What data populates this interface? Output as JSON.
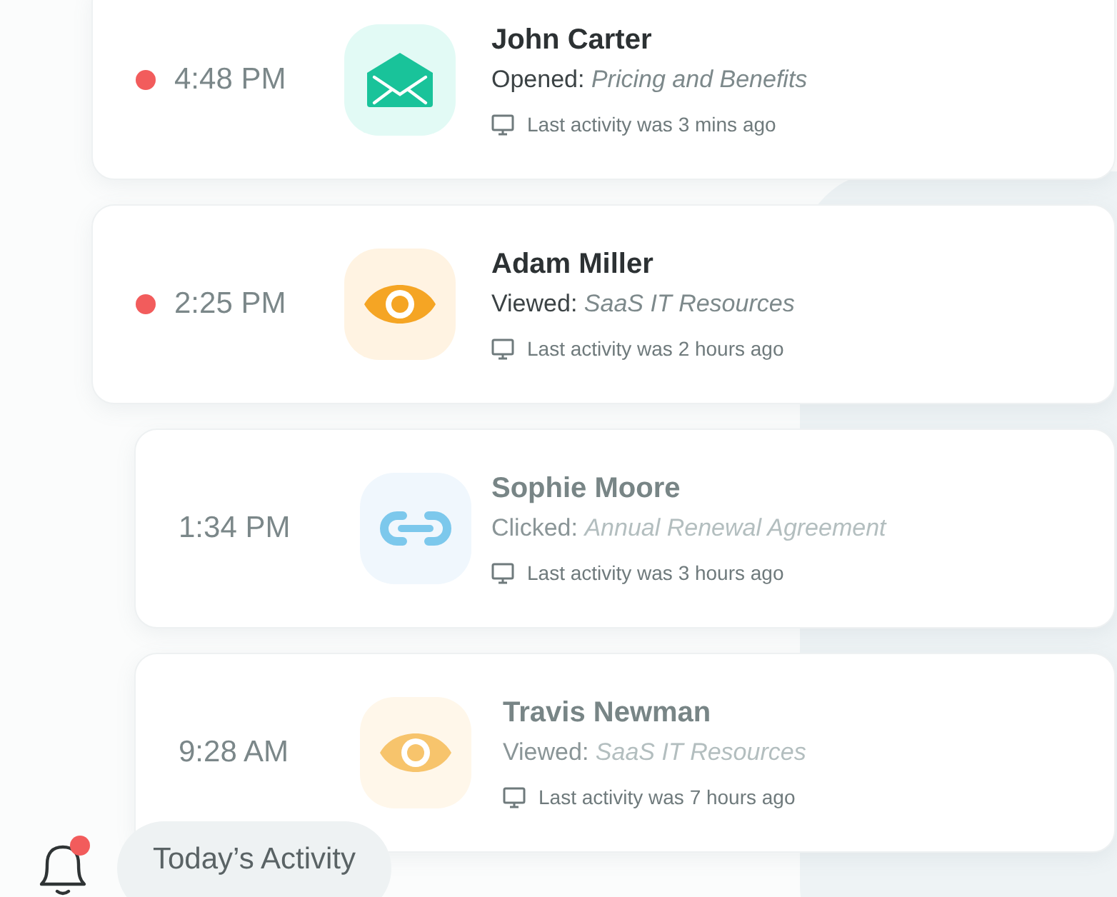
{
  "activities": [
    {
      "time": "4:48 PM",
      "unread": true,
      "kind": "opened",
      "name": "John Carter",
      "action": "Opened:",
      "subject": "Pricing and Benefits",
      "last_activity": "Last activity was 3 mins ago"
    },
    {
      "time": "2:25 PM",
      "unread": true,
      "kind": "viewed",
      "name": "Adam Miller",
      "action": "Viewed:",
      "subject": "SaaS IT Resources",
      "last_activity": "Last activity was 2 hours ago"
    },
    {
      "time": "1:34 PM",
      "unread": false,
      "kind": "clicked",
      "name": "Sophie Moore",
      "action": "Clicked:",
      "subject": "Annual Renewal Agreement",
      "last_activity": "Last activity was 3 hours ago"
    },
    {
      "time": "9:28 AM",
      "unread": false,
      "kind": "viewed",
      "name": "Travis Newman",
      "action": "Viewed:",
      "subject": "SaaS IT Resources",
      "last_activity": "Last activity was 7 hours ago"
    }
  ],
  "footer": {
    "bell_badge": true,
    "label": "Today’s Activity"
  }
}
